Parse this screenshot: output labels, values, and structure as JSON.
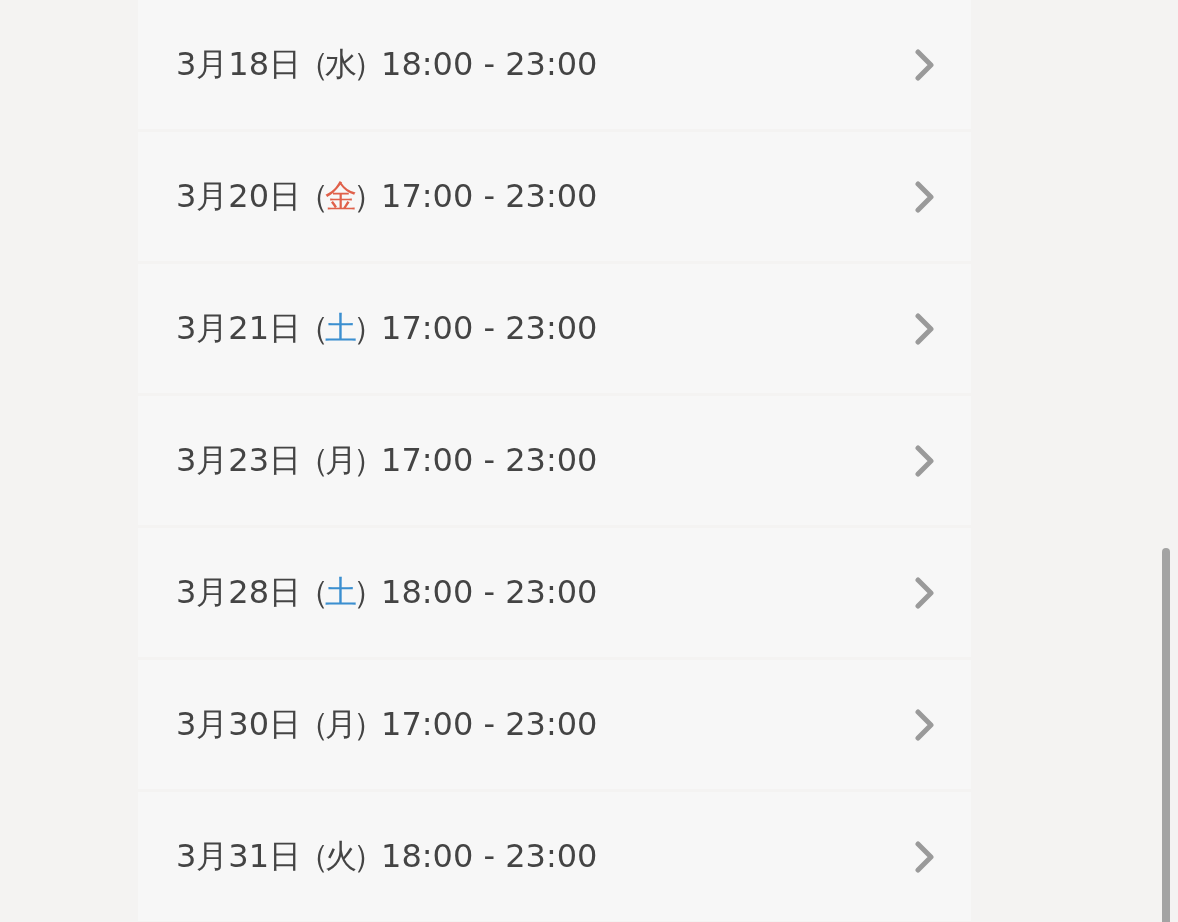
{
  "schedule": [
    {
      "date": "3月18日",
      "open": "（",
      "weekday": "水",
      "close": "）",
      "color": "#444444",
      "time": "18:00 - 23:00"
    },
    {
      "date": "3月20日",
      "open": "（",
      "weekday": "金",
      "close": "）",
      "color": "#e0604a",
      "time": "17:00 - 23:00"
    },
    {
      "date": "3月21日",
      "open": "（",
      "weekday": "土",
      "close": "）",
      "color": "#3b8fd0",
      "time": "17:00 - 23:00"
    },
    {
      "date": "3月23日",
      "open": "（",
      "weekday": "月",
      "close": "）",
      "color": "#444444",
      "time": "17:00 - 23:00"
    },
    {
      "date": "3月28日",
      "open": "（",
      "weekday": "土",
      "close": "）",
      "color": "#3b8fd0",
      "time": "18:00 - 23:00"
    },
    {
      "date": "3月30日",
      "open": "（",
      "weekday": "月",
      "close": "）",
      "color": "#444444",
      "time": "17:00 - 23:00"
    },
    {
      "date": "3月31日",
      "open": "（",
      "weekday": "火",
      "close": "）",
      "color": "#444444",
      "time": "18:00 - 23:00"
    }
  ]
}
